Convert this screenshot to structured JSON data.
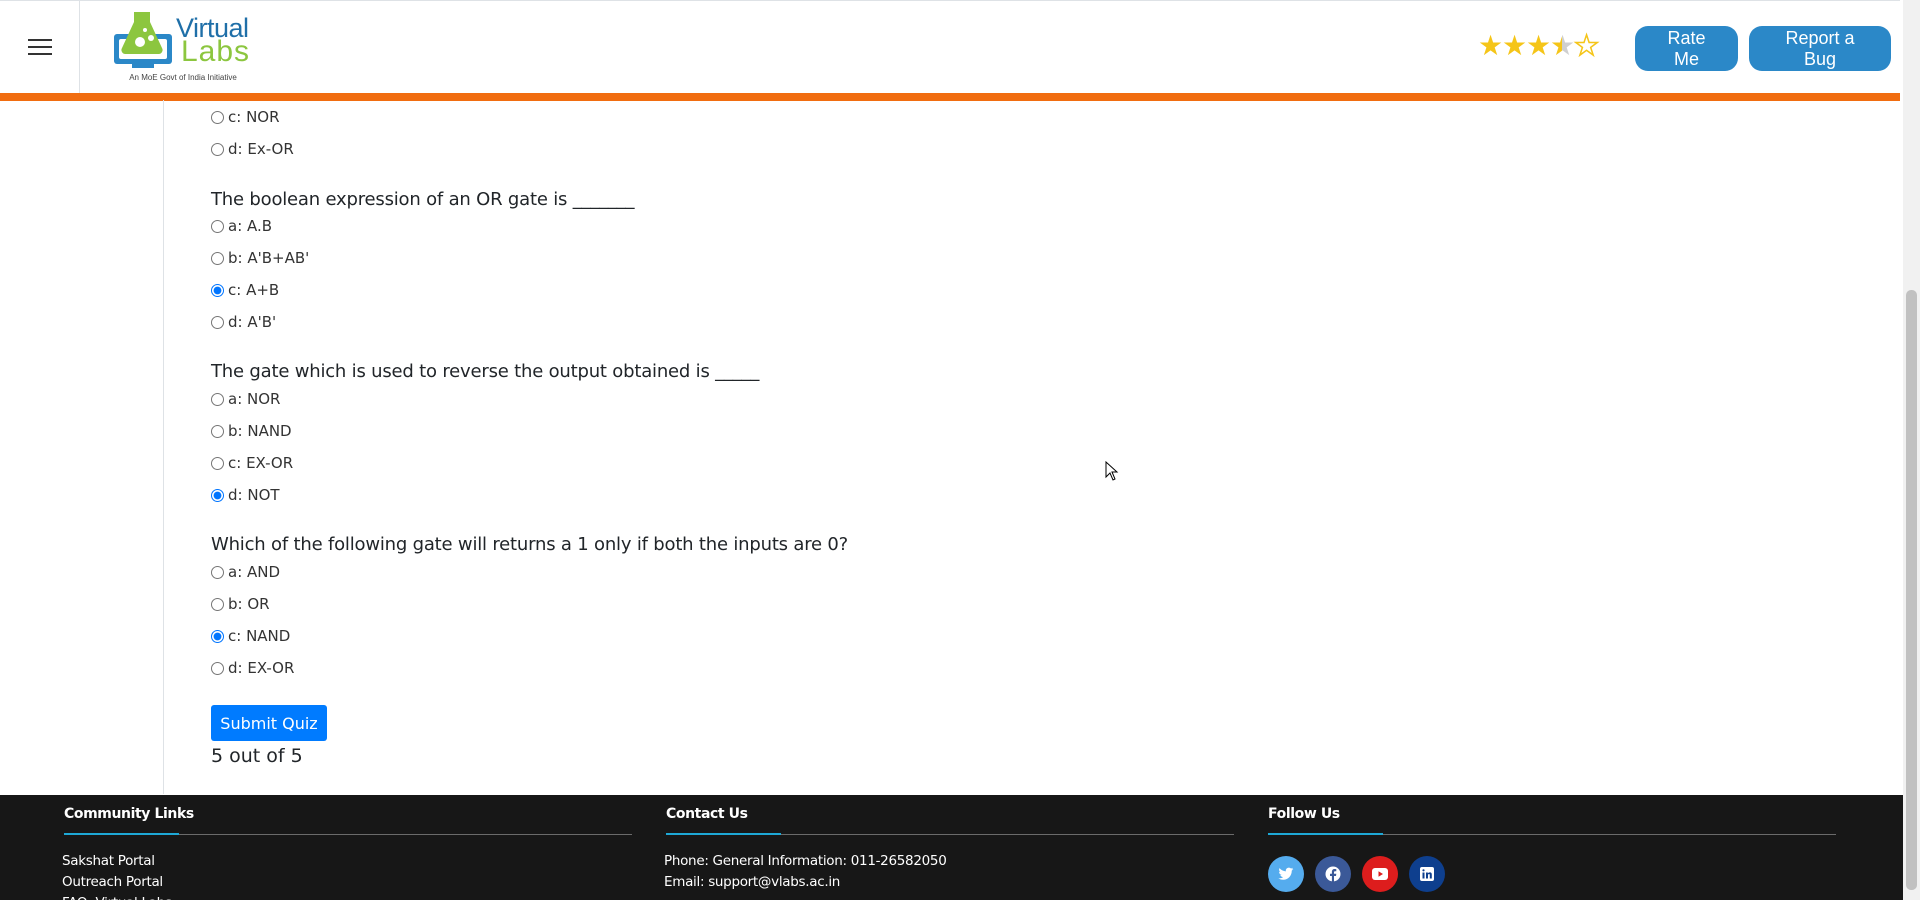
{
  "header": {
    "logo": {
      "word1": "Virtual",
      "word2": "Labs",
      "tagline": "An MoE Govt of India Initiative"
    },
    "rating": {
      "value": 3.5,
      "max": 5,
      "star_color": "#f5c518"
    },
    "rate_button": "Rate Me",
    "bug_button": "Report a Bug",
    "accent_color": "#f16d10"
  },
  "quiz": {
    "partial_question": {
      "options": [
        {
          "label": "c: NOR",
          "checked": false
        },
        {
          "label": "d: Ex-OR",
          "checked": false
        }
      ]
    },
    "questions": [
      {
        "text": "The boolean expression of an OR gate is _______",
        "options": [
          {
            "label": "a: A.B",
            "checked": false
          },
          {
            "label": "b: A'B+AB'",
            "checked": false
          },
          {
            "label": "c: A+B",
            "checked": true
          },
          {
            "label": "d: A'B'",
            "checked": false
          }
        ]
      },
      {
        "text": "The gate which is used to reverse the output obtained is _____",
        "options": [
          {
            "label": "a: NOR",
            "checked": false
          },
          {
            "label": "b: NAND",
            "checked": false
          },
          {
            "label": "c: EX-OR",
            "checked": false
          },
          {
            "label": "d: NOT",
            "checked": true
          }
        ]
      },
      {
        "text": "Which of the following gate will returns a 1 only if both the inputs are 0?",
        "options": [
          {
            "label": "a: AND",
            "checked": false
          },
          {
            "label": "b: OR",
            "checked": false
          },
          {
            "label": "c: NAND",
            "checked": true
          },
          {
            "label": "d: EX-OR",
            "checked": false
          }
        ]
      }
    ],
    "submit_label": "Submit Quiz",
    "score_text": "5 out of 5"
  },
  "footer": {
    "community": {
      "title": "Community Links",
      "links": [
        "Sakshat Portal",
        "Outreach Portal",
        "FAQ: Virtual Labs"
      ]
    },
    "contact": {
      "title": "Contact Us",
      "phone": "Phone: General Information: 011-26582050",
      "email": "Email: support@vlabs.ac.in"
    },
    "follow": {
      "title": "Follow Us",
      "icons": [
        {
          "name": "twitter-icon",
          "color": "#55acee"
        },
        {
          "name": "facebook-icon",
          "color": "#3b5998"
        },
        {
          "name": "youtube-icon",
          "color": "#dd1d1d"
        },
        {
          "name": "linkedin-icon",
          "color": "#0e3f8e"
        }
      ]
    },
    "accent_color": "#1ea8d6"
  }
}
